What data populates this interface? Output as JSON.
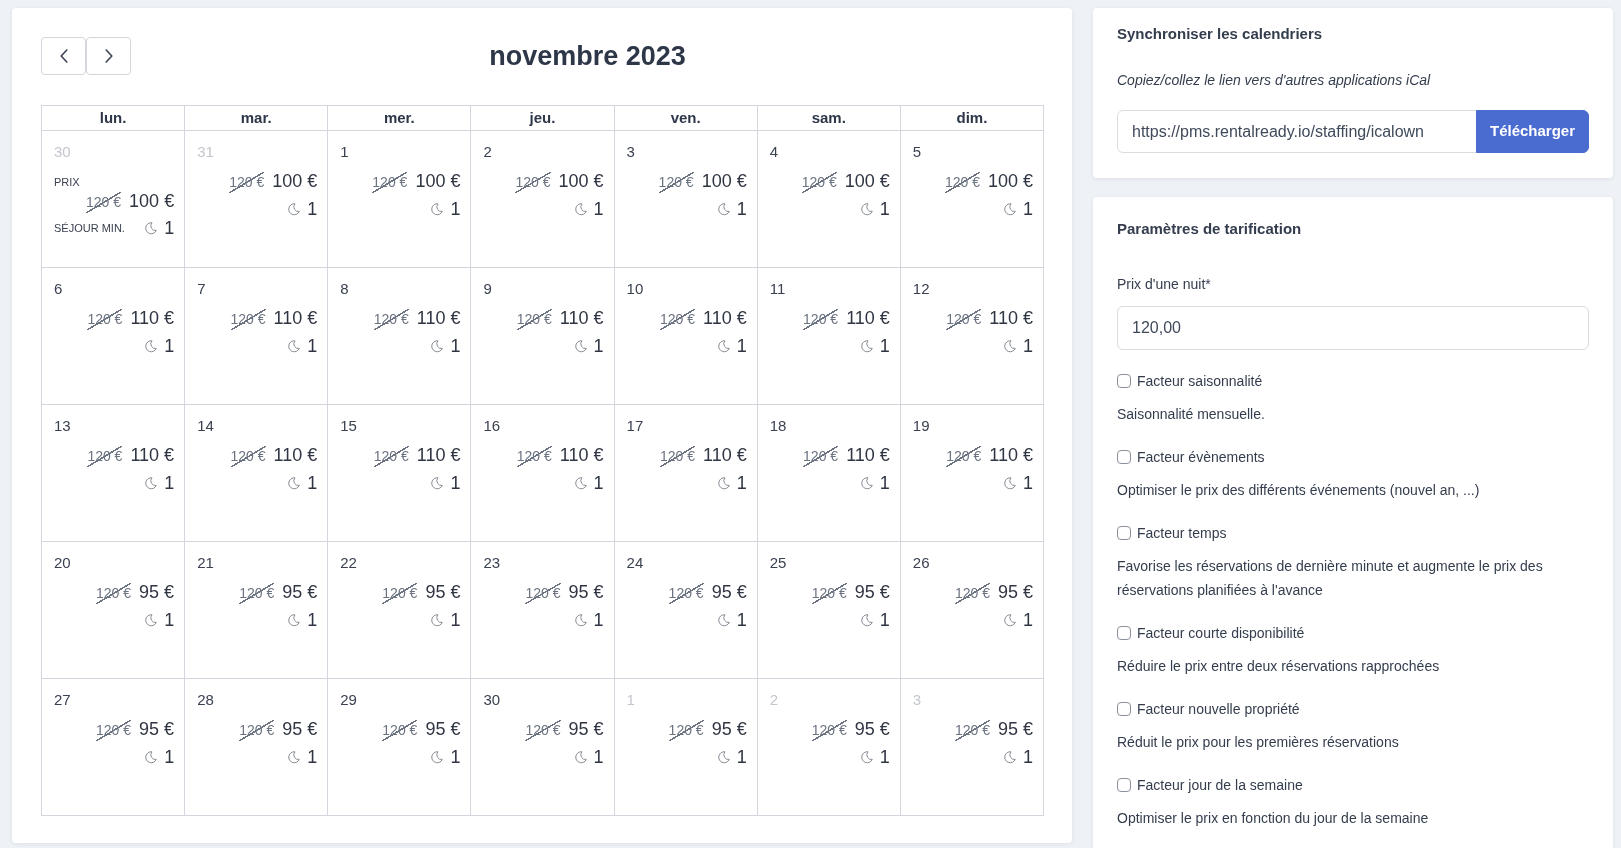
{
  "calendar": {
    "title": "novembre 2023",
    "weekdays": [
      "lun.",
      "mar.",
      "mer.",
      "jeu.",
      "ven.",
      "sam.",
      "dim."
    ],
    "weeks": [
      [
        {
          "day": "30",
          "outside": true,
          "price_label": "PRIX",
          "old_price": "120 €",
          "price": "100 €",
          "min_stay_label": "SÉJOUR MIN.",
          "min_stay": "1"
        },
        {
          "day": "31",
          "outside": true,
          "old_price": "120 €",
          "price": "100 €",
          "min_stay": "1"
        },
        {
          "day": "1",
          "outside": false,
          "old_price": "120 €",
          "price": "100 €",
          "min_stay": "1"
        },
        {
          "day": "2",
          "outside": false,
          "old_price": "120 €",
          "price": "100 €",
          "min_stay": "1"
        },
        {
          "day": "3",
          "outside": false,
          "old_price": "120 €",
          "price": "100 €",
          "min_stay": "1"
        },
        {
          "day": "4",
          "outside": false,
          "old_price": "120 €",
          "price": "100 €",
          "min_stay": "1"
        },
        {
          "day": "5",
          "outside": false,
          "old_price": "120 €",
          "price": "100 €",
          "min_stay": "1"
        }
      ],
      [
        {
          "day": "6",
          "outside": false,
          "old_price": "120 €",
          "price": "110 €",
          "min_stay": "1"
        },
        {
          "day": "7",
          "outside": false,
          "old_price": "120 €",
          "price": "110 €",
          "min_stay": "1"
        },
        {
          "day": "8",
          "outside": false,
          "old_price": "120 €",
          "price": "110 €",
          "min_stay": "1"
        },
        {
          "day": "9",
          "outside": false,
          "old_price": "120 €",
          "price": "110 €",
          "min_stay": "1"
        },
        {
          "day": "10",
          "outside": false,
          "old_price": "120 €",
          "price": "110 €",
          "min_stay": "1"
        },
        {
          "day": "11",
          "outside": false,
          "old_price": "120 €",
          "price": "110 €",
          "min_stay": "1"
        },
        {
          "day": "12",
          "outside": false,
          "old_price": "120 €",
          "price": "110 €",
          "min_stay": "1"
        }
      ],
      [
        {
          "day": "13",
          "outside": false,
          "old_price": "120 €",
          "price": "110 €",
          "min_stay": "1"
        },
        {
          "day": "14",
          "outside": false,
          "old_price": "120 €",
          "price": "110 €",
          "min_stay": "1"
        },
        {
          "day": "15",
          "outside": false,
          "old_price": "120 €",
          "price": "110 €",
          "min_stay": "1"
        },
        {
          "day": "16",
          "outside": false,
          "old_price": "120 €",
          "price": "110 €",
          "min_stay": "1"
        },
        {
          "day": "17",
          "outside": false,
          "old_price": "120 €",
          "price": "110 €",
          "min_stay": "1"
        },
        {
          "day": "18",
          "outside": false,
          "old_price": "120 €",
          "price": "110 €",
          "min_stay": "1"
        },
        {
          "day": "19",
          "outside": false,
          "old_price": "120 €",
          "price": "110 €",
          "min_stay": "1"
        }
      ],
      [
        {
          "day": "20",
          "outside": false,
          "old_price": "120 €",
          "price": "95 €",
          "min_stay": "1"
        },
        {
          "day": "21",
          "outside": false,
          "old_price": "120 €",
          "price": "95 €",
          "min_stay": "1"
        },
        {
          "day": "22",
          "outside": false,
          "old_price": "120 €",
          "price": "95 €",
          "min_stay": "1"
        },
        {
          "day": "23",
          "outside": false,
          "old_price": "120 €",
          "price": "95 €",
          "min_stay": "1"
        },
        {
          "day": "24",
          "outside": false,
          "old_price": "120 €",
          "price": "95 €",
          "min_stay": "1"
        },
        {
          "day": "25",
          "outside": false,
          "old_price": "120 €",
          "price": "95 €",
          "min_stay": "1"
        },
        {
          "day": "26",
          "outside": false,
          "old_price": "120 €",
          "price": "95 €",
          "min_stay": "1"
        }
      ],
      [
        {
          "day": "27",
          "outside": false,
          "old_price": "120 €",
          "price": "95 €",
          "min_stay": "1"
        },
        {
          "day": "28",
          "outside": false,
          "old_price": "120 €",
          "price": "95 €",
          "min_stay": "1"
        },
        {
          "day": "29",
          "outside": false,
          "old_price": "120 €",
          "price": "95 €",
          "min_stay": "1"
        },
        {
          "day": "30",
          "outside": false,
          "old_price": "120 €",
          "price": "95 €",
          "min_stay": "1"
        },
        {
          "day": "1",
          "outside": true,
          "old_price": "120 €",
          "price": "95 €",
          "min_stay": "1"
        },
        {
          "day": "2",
          "outside": true,
          "old_price": "120 €",
          "price": "95 €",
          "min_stay": "1"
        },
        {
          "day": "3",
          "outside": true,
          "old_price": "120 €",
          "price": "95 €",
          "min_stay": "1"
        }
      ]
    ]
  },
  "sync": {
    "title": "Synchroniser les calendriers",
    "hint": "Copiez/collez le lien vers d'autres applications iCal",
    "url": "https://pms.rentalready.io/staffing/icalown",
    "button": "Télécharger"
  },
  "pricing": {
    "title": "Paramètres de tarification",
    "price_field": {
      "label": "Prix d'une nuit*",
      "value": "120,00"
    },
    "factors": [
      {
        "label": "Facteur saisonnalité",
        "checked": false,
        "description": "Saisonnalité mensuelle."
      },
      {
        "label": "Facteur évènements",
        "checked": false,
        "description": "Optimiser le prix des différents événements (nouvel an, ...)"
      },
      {
        "label": "Facteur temps",
        "checked": false,
        "description": "Favorise les réservations de dernière minute et augmente le prix des réservations planifiées à l'avance"
      },
      {
        "label": "Facteur courte disponibilité",
        "checked": false,
        "description": "Réduire le prix entre deux réservations rapprochées"
      },
      {
        "label": "Facteur nouvelle propriété",
        "checked": false,
        "description": "Réduit le prix pour les premières réservations"
      },
      {
        "label": "Facteur jour de la semaine",
        "checked": false,
        "description": "Optimiser le prix en fonction du jour de la semaine"
      }
    ]
  }
}
